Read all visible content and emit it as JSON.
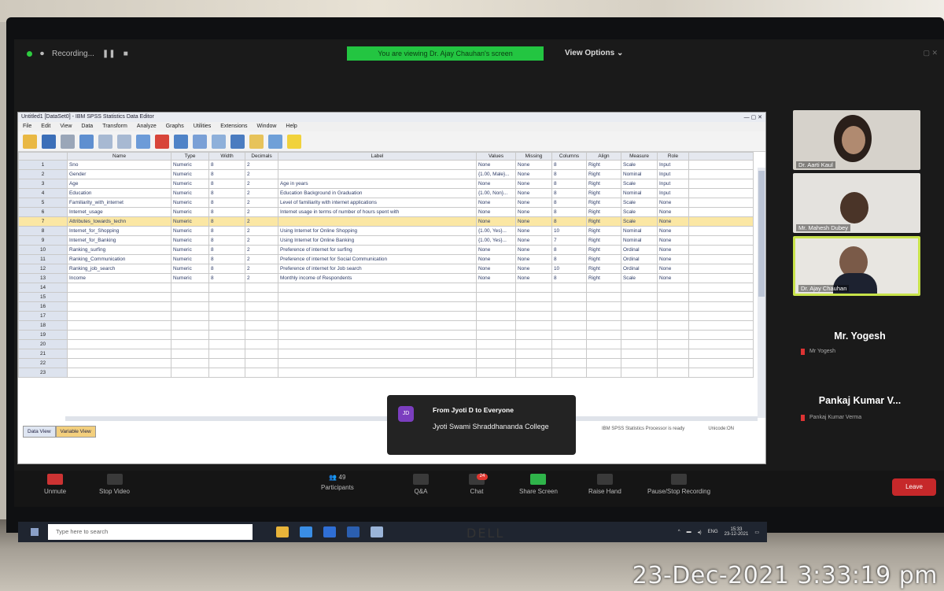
{
  "zoom": {
    "recording": "Recording...",
    "viewing": "You are viewing Dr. Ajay Chauhan's screen",
    "view_options": "View Options",
    "participants_count": "49",
    "chat_badge": "24",
    "controls": [
      "Unmute",
      "Stop Video",
      "Participants",
      "Q&A",
      "Chat",
      "Share Screen",
      "Raise Hand",
      "Pause/Stop Recording"
    ],
    "leave": "Leave"
  },
  "spss": {
    "title": "Untitled1 [DataSet0] - IBM SPSS Statistics Data Editor",
    "menus": [
      "File",
      "Edit",
      "View",
      "Data",
      "Transform",
      "Analyze",
      "Graphs",
      "Utilities",
      "Extensions",
      "Window",
      "Help"
    ],
    "columns": [
      "Name",
      "Type",
      "Width",
      "Decimals",
      "Label",
      "Values",
      "Missing",
      "Columns",
      "Align",
      "Measure",
      "Role"
    ],
    "rows": [
      [
        "1",
        "Sno",
        "Numeric",
        "8",
        "2",
        "",
        "None",
        "None",
        "8",
        "Right",
        "Scale",
        "Input"
      ],
      [
        "2",
        "Gender",
        "Numeric",
        "8",
        "2",
        "",
        "{1.00, Male}...",
        "None",
        "8",
        "Right",
        "Nominal",
        "Input"
      ],
      [
        "3",
        "Age",
        "Numeric",
        "8",
        "2",
        "Age in years",
        "None",
        "None",
        "8",
        "Right",
        "Scale",
        "Input"
      ],
      [
        "4",
        "Education",
        "Numeric",
        "8",
        "2",
        "Education Background in Graduation",
        "{1.00, Non}...",
        "None",
        "8",
        "Right",
        "Nominal",
        "Input"
      ],
      [
        "5",
        "Familiarity_with_internet",
        "Numeric",
        "8",
        "2",
        "Level of familiarity with internet applications",
        "None",
        "None",
        "8",
        "Right",
        "Scale",
        "None"
      ],
      [
        "6",
        "Internet_usage",
        "Numeric",
        "8",
        "2",
        "Internet usage in terms of number of hours spent with",
        "None",
        "None",
        "8",
        "Right",
        "Scale",
        "None"
      ],
      [
        "7",
        "Attributes_towards_techn",
        "Numeric",
        "8",
        "2",
        "",
        "None",
        "None",
        "8",
        "Right",
        "Scale",
        "None"
      ],
      [
        "8",
        "Internet_for_Shopping",
        "Numeric",
        "8",
        "2",
        "Using Internet for Online Shopping",
        "{1.00, Yes}...",
        "None",
        "10",
        "Right",
        "Nominal",
        "None"
      ],
      [
        "9",
        "Internet_for_Banking",
        "Numeric",
        "8",
        "2",
        "Using Internet for Online Banking",
        "{1.00, Yes}...",
        "None",
        "7",
        "Right",
        "Nominal",
        "None"
      ],
      [
        "10",
        "Ranking_surfing",
        "Numeric",
        "8",
        "2",
        "Preference of internet for surfing",
        "None",
        "None",
        "8",
        "Right",
        "Ordinal",
        "None"
      ],
      [
        "11",
        "Ranking_Communication",
        "Numeric",
        "8",
        "2",
        "Preference of internet for Social Communication",
        "None",
        "None",
        "8",
        "Right",
        "Ordinal",
        "None"
      ],
      [
        "12",
        "Ranking_job_search",
        "Numeric",
        "8",
        "2",
        "Preference of internet for Job search",
        "None",
        "None",
        "10",
        "Right",
        "Ordinal",
        "None"
      ],
      [
        "13",
        "Income",
        "Numeric",
        "8",
        "2",
        "Monthly income of Respondents",
        "None",
        "None",
        "8",
        "Right",
        "Scale",
        "None"
      ]
    ],
    "empty_row_numbers": [
      "14",
      "15",
      "16",
      "17",
      "18",
      "19",
      "20",
      "21",
      "22",
      "23"
    ],
    "tab_data": "Data View",
    "tab_variable": "Variable View",
    "status_left": "IBM SPSS Statistics Processor is ready",
    "status_right": "Unicode:ON",
    "taskbar_search": "Type here to search",
    "tray_lang": "ENG",
    "tray_time": "15:33",
    "tray_date": "23-12-2021"
  },
  "chat_popup": {
    "avatar": "JD",
    "from": "From Jyoti D to Everyone",
    "message": "Jyoti Swami Shraddhananda College"
  },
  "participants": {
    "tiles": [
      "Dr. Aarti Kaul",
      "Mr. Mahesh Dubey",
      "Dr. Ajay Chauhan"
    ],
    "names": [
      {
        "big": "Mr. Yogesh",
        "small": "Mr Yogesh"
      },
      {
        "big": "Pankaj Kumar V...",
        "small": "Pankaj Kumar Verma"
      }
    ]
  },
  "photo": {
    "brand": "DELL",
    "timestamp": "23-Dec-2021 3:33:19 pm"
  }
}
